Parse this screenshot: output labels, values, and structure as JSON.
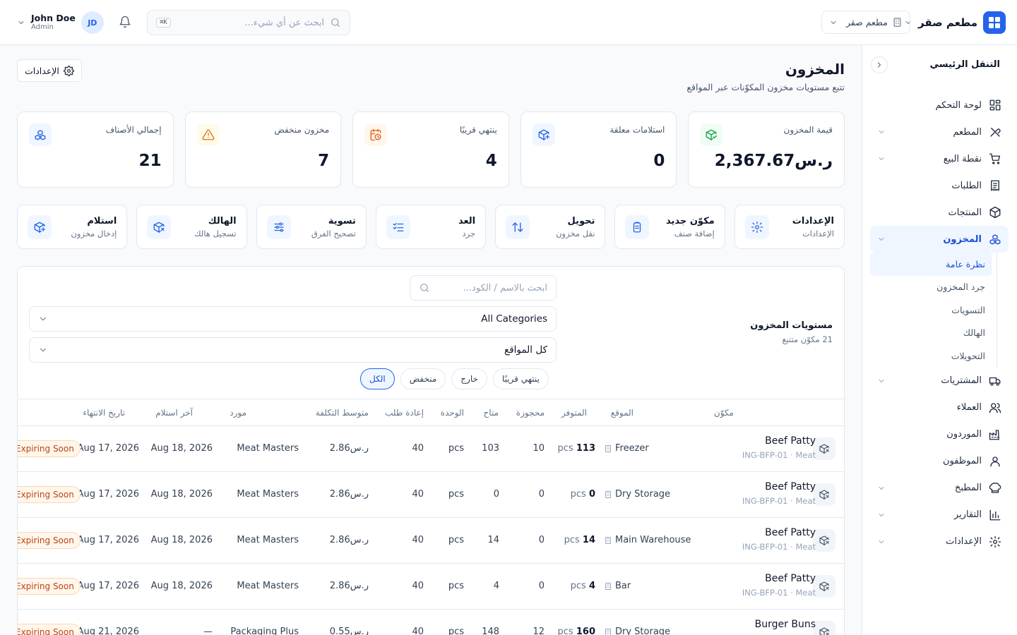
{
  "header": {
    "brand_name": "مطعم صقر",
    "branch_label": "مطعم صقر",
    "search_placeholder": "ابحث عن أي شيء...",
    "search_shortcut": "K⌘",
    "user_name": "John Doe",
    "user_role": "Admin",
    "user_initials": "JD"
  },
  "sidebar": {
    "title": "التنقل الرئيسي",
    "items": [
      {
        "label": "لوحة التحكم",
        "icon": "dashboard-icon",
        "expandable": false
      },
      {
        "label": "المطعم",
        "icon": "utensils-icon",
        "expandable": true
      },
      {
        "label": "نقطة البيع",
        "icon": "cart-icon",
        "expandable": true
      },
      {
        "label": "الطلبات",
        "icon": "receipt-icon",
        "expandable": false
      },
      {
        "label": "المنتجات",
        "icon": "box-icon",
        "expandable": false
      },
      {
        "label": "المخزون",
        "icon": "boxes-icon",
        "expandable": true,
        "active": true
      },
      {
        "label": "المشتريات",
        "icon": "truck-icon",
        "expandable": true
      },
      {
        "label": "العملاء",
        "icon": "users-icon",
        "expandable": false
      },
      {
        "label": "الموردون",
        "icon": "factory-icon",
        "expandable": false
      },
      {
        "label": "الموظفون",
        "icon": "user-icon",
        "expandable": false
      },
      {
        "label": "المطبخ",
        "icon": "chef-hat-icon",
        "expandable": true
      },
      {
        "label": "التقارير",
        "icon": "bar-chart-icon",
        "expandable": true
      },
      {
        "label": "الإعدادات",
        "icon": "settings-icon",
        "expandable": true
      }
    ],
    "inventory_sub": [
      "نظرة عامة",
      "جرد المخزون",
      "التسويات",
      "الهالك",
      "التحويلات"
    ]
  },
  "page": {
    "title": "المخزون",
    "subtitle": "تتبع مستويات مخزون المكوّنات عبر المواقع",
    "settings_button": "الإعدادات"
  },
  "stats": [
    {
      "label": "إجمالي الأصناف",
      "value": "21",
      "icon": "boxes-icon",
      "tone": "blue"
    },
    {
      "label": "مخزون منخفض",
      "value": "7",
      "icon": "alert-triangle-icon",
      "tone": "amber"
    },
    {
      "label": "ينتهي قريبًا",
      "value": "4",
      "icon": "calendar-clock-icon",
      "tone": "orange"
    },
    {
      "label": "استلامات معلقة",
      "value": "0",
      "icon": "package-plus-icon",
      "tone": "blue"
    },
    {
      "label": "قيمة المخزون",
      "value": "ر.س2,367.67",
      "icon": "package-check-icon",
      "tone": "green"
    }
  ],
  "colors": {
    "accent": "#2563eb",
    "amber": "#d97706",
    "orange": "#ea580c",
    "green": "#16a34a",
    "warning_badge": "#c2410c"
  },
  "actions": [
    {
      "title": "استلام",
      "sub": "إدخال مخزون",
      "icon": "package-plus-icon"
    },
    {
      "title": "الهالك",
      "sub": "تسجيل هالك",
      "icon": "package-x-icon"
    },
    {
      "title": "تسوية",
      "sub": "تصحيح الفرق",
      "icon": "sliders-icon"
    },
    {
      "title": "العد",
      "sub": "جرد",
      "icon": "list-checks-icon"
    },
    {
      "title": "تحويل",
      "sub": "نقل مخزون",
      "icon": "arrow-up-down-icon"
    },
    {
      "title": "مكوّن جديد",
      "sub": "إضافة صنف",
      "icon": "clipboard-icon"
    },
    {
      "title": "الإعدادات",
      "sub": "الإعدادات",
      "icon": "settings-icon"
    }
  ],
  "panel": {
    "title": "مستويات المخزون",
    "subtitle": "21 مكوّن متتبع",
    "search_placeholder": "ابحث بالاسم / الكود...",
    "category_select": "All Categories",
    "location_select": "كل المواقع",
    "chips": [
      "الكل",
      "منخفض",
      "خارج",
      "ينتهي قريبًا"
    ],
    "active_chip": 0
  },
  "table": {
    "headers": {
      "ingredient": "مكوّن",
      "location": "الموقع",
      "available": "المتوفر",
      "reserved": "محجوزة",
      "free": "متاح",
      "unit": "الوحدة",
      "reorder": "إعادة طلب",
      "avg_cost": "متوسط التكلفة",
      "supplier": "مورد",
      "last_receipt": "آخر استلام",
      "expiry": "تاريخ الانتهاء"
    },
    "rows": [
      {
        "name": "Beef Patty",
        "meta": "ING-BFP-01 · Meat",
        "location": "Freezer",
        "available": "113",
        "available_unit": "pcs",
        "reserved": "10",
        "free": "103",
        "unit": "pcs",
        "reorder": "40",
        "avg_cost": "ر.س2.86",
        "supplier": "Meat Masters",
        "last_receipt": "Aug 18, 2026",
        "expiry": "Aug 17, 2026",
        "status": "Expiring Soon"
      },
      {
        "name": "Beef Patty",
        "meta": "ING-BFP-01 · Meat",
        "location": "Dry Storage",
        "available": "0",
        "available_unit": "pcs",
        "reserved": "0",
        "free": "0",
        "unit": "pcs",
        "reorder": "40",
        "avg_cost": "ر.س2.86",
        "supplier": "Meat Masters",
        "last_receipt": "Aug 18, 2026",
        "expiry": "Aug 17, 2026",
        "status": "Expiring Soon"
      },
      {
        "name": "Beef Patty",
        "meta": "ING-BFP-01 · Meat",
        "location": "Main Warehouse",
        "available": "14",
        "available_unit": "pcs",
        "reserved": "0",
        "free": "14",
        "unit": "pcs",
        "reorder": "40",
        "avg_cost": "ر.س2.86",
        "supplier": "Meat Masters",
        "last_receipt": "Aug 18, 2026",
        "expiry": "Aug 17, 2026",
        "status": "Expiring Soon"
      },
      {
        "name": "Beef Patty",
        "meta": "ING-BFP-01 · Meat",
        "location": "Bar",
        "available": "4",
        "available_unit": "pcs",
        "reserved": "0",
        "free": "4",
        "unit": "pcs",
        "reorder": "40",
        "avg_cost": "ر.س2.86",
        "supplier": "Meat Masters",
        "last_receipt": "Aug 18, 2026",
        "expiry": "Aug 17, 2026",
        "status": "Expiring Soon"
      },
      {
        "name": "Burger Buns",
        "meta": "",
        "location": "Dry Storage",
        "available": "160",
        "available_unit": "pcs",
        "reserved": "12",
        "free": "148",
        "unit": "pcs",
        "reorder": "40",
        "avg_cost": "ر.س0.55",
        "supplier": "Packaging Plus",
        "last_receipt": "—",
        "expiry": "Aug 21, 2026",
        "status": "Expiring Soon"
      }
    ]
  }
}
